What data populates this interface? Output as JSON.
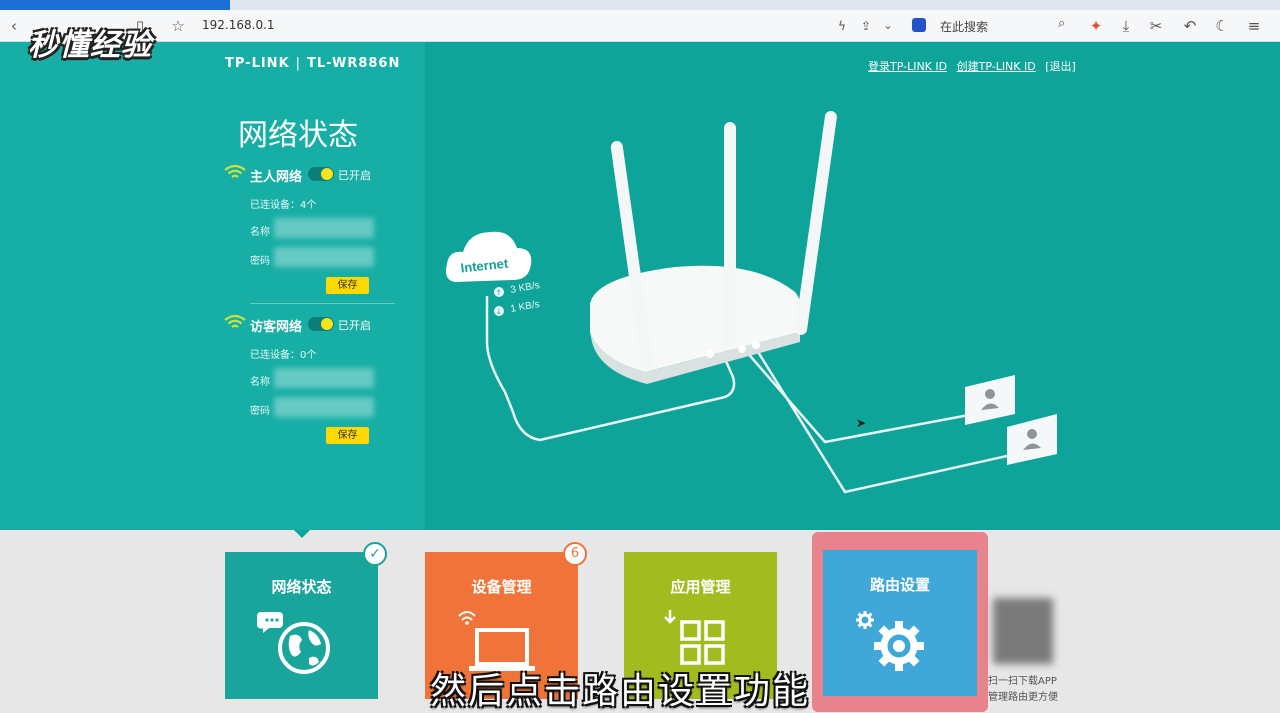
{
  "browser": {
    "url": "192.168.0.1",
    "search_placeholder": "在此搜索"
  },
  "watermark": "秒懂经验",
  "header": {
    "brand": "TP-LINK",
    "model": "TL-WR886N",
    "link_login": "登录TP-LINK ID",
    "link_create": "创建TP-LINK ID",
    "link_logout": "[退出]"
  },
  "status_panel": {
    "title": "网络状态",
    "host_network": {
      "name": "主人网络",
      "toggle_label": "已开启",
      "devices": "已连设备：4个",
      "name_label": "名称",
      "password_label": "密码",
      "save": "保存"
    },
    "guest_network": {
      "name": "访客网络",
      "toggle_label": "已开启",
      "devices": "已连设备：0个",
      "name_label": "名称",
      "password_label": "密码",
      "save": "保存"
    }
  },
  "illustration": {
    "internet": "Internet",
    "upload": "3 KB/s",
    "download": "1 KB/s"
  },
  "tiles": [
    {
      "label": "网络状态",
      "badge": "✓"
    },
    {
      "label": "设备管理",
      "badge": "6"
    },
    {
      "label": "应用管理"
    },
    {
      "label": "路由设置"
    }
  ],
  "app_promo": {
    "line1": "扫一扫下载APP",
    "line2": "管理路由更方便"
  },
  "subtitle": "然后点击路由设置功能",
  "colors": {
    "teal": "#0fa49a",
    "orange": "#f07439",
    "olive": "#a2bc20",
    "blue": "#3fa8d8",
    "highlight": "#e87b86"
  }
}
